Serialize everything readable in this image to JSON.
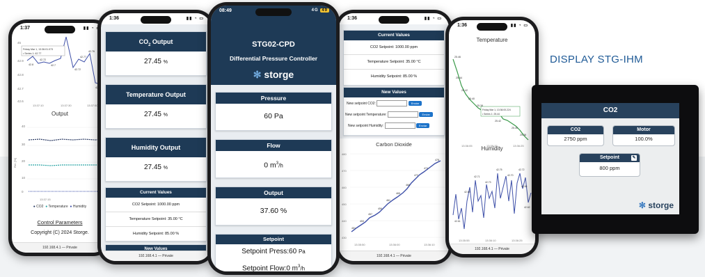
{
  "display_label": "DISPLAY STG-IHM",
  "phone1": {
    "time": "1:37",
    "tooltip_line1": "Friday Mar 1, 13:36:01.073",
    "tooltip_line2": "• Series 1: 42.77",
    "chart_values": [
      "42.8",
      "42.77",
      "42.72",
      "42.72",
      "42.7",
      "42.72",
      "42.77",
      "42.76",
      "42.68",
      "42.8"
    ],
    "y_ticks": [
      "45",
      "42.9",
      "42.8",
      "42.7",
      "42.6"
    ],
    "x_ticks": [
      "13:37:10",
      "13:37:30",
      "13:37:50"
    ],
    "output_title": "Output",
    "output_y_ticks": [
      "40",
      "30",
      "20",
      "10",
      "0"
    ],
    "output_y_label": "Rel. [%]",
    "output_x_tick": "13:37:15",
    "legend": [
      "CO2",
      "Temperature",
      "Humidity"
    ],
    "link": "Control Parameters",
    "copyright": "Copyright (C) 2024 Storge.",
    "footer": "192.168.4.1 — Private"
  },
  "phone2": {
    "time": "1:36",
    "cards": [
      {
        "title_pre": "CO",
        "title_sub": "2",
        "title_post": " Output",
        "value": "27.45",
        "unit": "%"
      },
      {
        "title_pre": "Temperature Output",
        "title_sub": "",
        "title_post": "",
        "value": "27.45",
        "unit": "%"
      },
      {
        "title_pre": "Humidity Output",
        "title_sub": "",
        "title_post": "",
        "value": "27.45",
        "unit": "%"
      }
    ],
    "current_values_title": "Current Values",
    "current_values": [
      "CO2 Setpoint: 1000.00 ppm",
      "Temperature Setpoint: 35.00 °C",
      "Humidity Setpoint: 85.00 %"
    ],
    "new_values_title": "New Values",
    "footer": "192.168.4.1 — Private"
  },
  "phone3": {
    "time": "08:49",
    "network": "4G",
    "battery": "49",
    "title": "STG02-CPD",
    "subtitle": "Differential Pressure Controller",
    "logo": "storge",
    "pressure": {
      "title": "Pressure",
      "value": "60 Pa"
    },
    "flow": {
      "title": "Flow",
      "value": "0 m",
      "unit_sup": "3",
      "unit_rest": "/h"
    },
    "output": {
      "title": "Output",
      "value": "37.60 %"
    },
    "setpoint": {
      "title": "Setpoint",
      "press": "Setpoint Press:60",
      "press_unit": "Pa",
      "flow": "Setpoint Flow:0 m",
      "flow_sup": "3",
      "flow_rest": "/h"
    }
  },
  "phone4": {
    "time": "1:36",
    "current_values_title": "Current Values",
    "current_values": [
      "CO2 Setpoint: 1000.00 ppm",
      "Temperature Setpoint: 35.00 °C",
      "Humidity Setpoint: 85.00 %"
    ],
    "new_values_title": "New Values",
    "new_rows": [
      {
        "label": "New setpoint CO2:",
        "button": "Enviar"
      },
      {
        "label": "New setpoint Temperature:",
        "button": "Enviar"
      },
      {
        "label": "New setpoint Humidity:",
        "button": "Enviar"
      }
    ],
    "chart_title": "Carbon Dioxide",
    "point_labels": [
      "451",
      "452",
      "453",
      "455",
      "457",
      "458",
      "459",
      "460",
      "461",
      "463",
      "465",
      "466",
      "468",
      "470",
      "472",
      "473",
      "474",
      "476",
      "478"
    ],
    "y_ticks": [
      "480",
      "470",
      "460",
      "450",
      "440",
      "430"
    ],
    "x_ticks": [
      "13:35:50",
      "13:36:00",
      "13:36:10"
    ],
    "footer": "192.168.4.1 — Private"
  },
  "phone5": {
    "time": "1:36",
    "temp_title": "Temperature",
    "temp_labels": [
      "25.46",
      "25.45",
      "25.44",
      "25.43",
      "25.42",
      "25.41",
      "25.40",
      "25.39",
      "25.38",
      "25.44",
      "25.42",
      "25.41",
      "25.40",
      "25.39",
      "25.38"
    ],
    "tooltip_line1": "Friday Mar 1, 13:36:00.224",
    "tooltip_line2": "• Series 1: 25.44",
    "temp_x_ticks": [
      "13:36:05",
      "13:36:15",
      "13:36:25"
    ],
    "humidity_title": "Humidity",
    "hum_labels": [
      "42.61",
      "42.66",
      "42.69",
      "42.70",
      "42.71",
      "42.72",
      "42.73",
      "42.74",
      "42.75",
      "42.63",
      "42.67",
      "42.68",
      "42.64",
      "42.62",
      "42.60",
      "42.58",
      "42.65",
      "42.66"
    ],
    "hum_x_ticks": [
      "13:35:55",
      "13:36:10",
      "13:36:25"
    ],
    "footer": "192.168.4.1 — Private"
  },
  "display": {
    "title": "CO2",
    "co2": {
      "label": "CO2",
      "value": "2750",
      "unit": "ppm"
    },
    "motor": {
      "label": "Motor",
      "value": "100.0%"
    },
    "setpoint": {
      "label": "Setpoint",
      "value": "800",
      "unit": "ppm"
    },
    "logo": "storge"
  },
  "colors": {
    "navy": "#1e3a56",
    "accent_blue": "#1d73c9",
    "series_blue": "#3d4fa8",
    "series_teal": "#29a3a3",
    "series_dark": "#2a3a63",
    "series_green": "#3a9a4a"
  }
}
